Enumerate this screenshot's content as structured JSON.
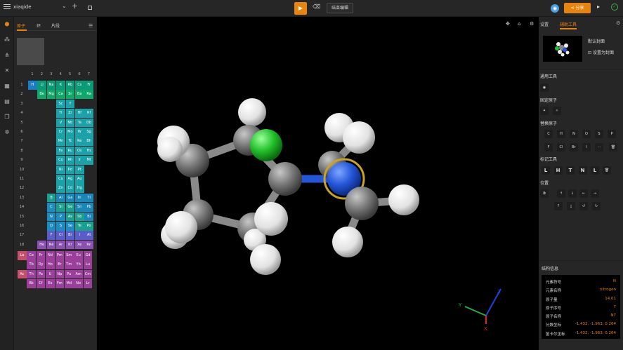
{
  "app": {
    "project_name": "xiaqide"
  },
  "topbar": {
    "end_edit_label": "结束编辑",
    "share_label": "分享",
    "play_icon": "play-icon"
  },
  "left_panel": {
    "tabs": [
      "原子",
      "环",
      "片段"
    ],
    "active_tab": 0,
    "group_numbers": [
      "1",
      "2",
      "3",
      "4",
      "5",
      "6",
      "7"
    ],
    "period_numbers": [
      "1",
      "2",
      "3",
      "4",
      "5",
      "6",
      "7",
      "8",
      "9",
      "10",
      "11",
      "12",
      "13",
      "14",
      "15",
      "16",
      "17",
      "18"
    ],
    "rows": [
      [
        {
          "s": "H",
          "c": "#1a7ec2"
        },
        {
          "s": "Li",
          "c": "#0b9a78"
        },
        {
          "s": "Na",
          "c": "#0b9a78"
        },
        {
          "s": "K",
          "c": "#0b9a78"
        },
        {
          "s": "Rb",
          "c": "#0b9a78"
        },
        {
          "s": "Cs",
          "c": "#0b9a78"
        },
        {
          "s": "Fr",
          "c": "#0b9a78"
        }
      ],
      [
        {
          "s": "Be",
          "c": "#10a76a"
        },
        {
          "s": "Mg",
          "c": "#10a76a"
        },
        {
          "s": "Ca",
          "c": "#10a76a"
        },
        {
          "s": "Sr",
          "c": "#10a76a"
        },
        {
          "s": "Ba",
          "c": "#10a76a"
        },
        {
          "s": "Ra",
          "c": "#10a76a"
        }
      ],
      [
        {
          "s": "Sc",
          "c": "#1aa2a8"
        },
        {
          "s": "Y",
          "c": "#1aa2a8"
        }
      ],
      [
        {
          "s": "Ti",
          "c": "#1aa2a8"
        },
        {
          "s": "Zr",
          "c": "#1aa2a8"
        },
        {
          "s": "Hf",
          "c": "#1aa2a8"
        },
        {
          "s": "Rf",
          "c": "#1aa2a8"
        }
      ],
      [
        {
          "s": "V",
          "c": "#1aa2a8"
        },
        {
          "s": "Nb",
          "c": "#1aa2a8"
        },
        {
          "s": "Ta",
          "c": "#1aa2a8"
        },
        {
          "s": "Db",
          "c": "#1aa2a8"
        }
      ],
      [
        {
          "s": "Cr",
          "c": "#1aa2a8"
        },
        {
          "s": "Mo",
          "c": "#1aa2a8"
        },
        {
          "s": "W",
          "c": "#1aa2a8"
        },
        {
          "s": "Sg",
          "c": "#1aa2a8"
        }
      ],
      [
        {
          "s": "Mn",
          "c": "#1aa2a8"
        },
        {
          "s": "Tc",
          "c": "#1aa2a8"
        },
        {
          "s": "Re",
          "c": "#1aa2a8"
        },
        {
          "s": "Bh",
          "c": "#1aa2a8"
        }
      ],
      [
        {
          "s": "Fe",
          "c": "#1aa2a8"
        },
        {
          "s": "Ru",
          "c": "#1aa2a8"
        },
        {
          "s": "Os",
          "c": "#1aa2a8"
        },
        {
          "s": "Hs",
          "c": "#1aa2a8"
        }
      ],
      [
        {
          "s": "Co",
          "c": "#1aa2a8"
        },
        {
          "s": "Rh",
          "c": "#1aa2a8"
        },
        {
          "s": "Ir",
          "c": "#1aa2a8"
        },
        {
          "s": "Mt",
          "c": "#1aa2a8"
        }
      ],
      [
        {
          "s": "Ni",
          "c": "#1aa2a8"
        },
        {
          "s": "Pd",
          "c": "#1aa2a8"
        },
        {
          "s": "Pt",
          "c": "#1aa2a8"
        }
      ],
      [
        {
          "s": "Cu",
          "c": "#1aa2a8"
        },
        {
          "s": "Ag",
          "c": "#1aa2a8"
        },
        {
          "s": "Au",
          "c": "#1aa2a8"
        }
      ],
      [
        {
          "s": "Zn",
          "c": "#1aa2a8"
        },
        {
          "s": "Cd",
          "c": "#1aa2a8"
        },
        {
          "s": "Hg",
          "c": "#1aa2a8"
        }
      ],
      [
        {
          "s": "B",
          "c": "#1ba090"
        },
        {
          "s": "Al",
          "c": "#1b86b8"
        },
        {
          "s": "Ga",
          "c": "#1b86b8"
        },
        {
          "s": "In",
          "c": "#1b86b8"
        },
        {
          "s": "Tl",
          "c": "#1b86b8"
        }
      ],
      [
        {
          "s": "C",
          "c": "#1b8dc0"
        },
        {
          "s": "Si",
          "c": "#1ba090"
        },
        {
          "s": "Ge",
          "c": "#1ba090"
        },
        {
          "s": "Sn",
          "c": "#1b86b8"
        },
        {
          "s": "Pb",
          "c": "#1b86b8"
        }
      ],
      [
        {
          "s": "N",
          "c": "#1b8dc0"
        },
        {
          "s": "P",
          "c": "#1b8dc0"
        },
        {
          "s": "As",
          "c": "#1ba090"
        },
        {
          "s": "Sb",
          "c": "#1ba090"
        },
        {
          "s": "Bi",
          "c": "#1b86b8"
        }
      ],
      [
        {
          "s": "O",
          "c": "#1b8dc0"
        },
        {
          "s": "S",
          "c": "#1b8dc0"
        },
        {
          "s": "Se",
          "c": "#1b8dc0"
        },
        {
          "s": "Te",
          "c": "#1ba090"
        },
        {
          "s": "Po",
          "c": "#1ba090"
        }
      ],
      [
        {
          "s": "F",
          "c": "#5a5cc8"
        },
        {
          "s": "Cl",
          "c": "#5a5cc8"
        },
        {
          "s": "Br",
          "c": "#5a5cc8"
        },
        {
          "s": "I",
          "c": "#5a5cc8"
        },
        {
          "s": "At",
          "c": "#5a5cc8"
        }
      ],
      [
        {
          "s": "He",
          "c": "#8a4fb0"
        },
        {
          "s": "Ne",
          "c": "#8a4fb0"
        },
        {
          "s": "Ar",
          "c": "#8a4fb0"
        },
        {
          "s": "Kr",
          "c": "#8a4fb0"
        },
        {
          "s": "Xe",
          "c": "#8a4fb0"
        },
        {
          "s": "Rn",
          "c": "#8a4fb0"
        }
      ]
    ],
    "f_rows": [
      [
        {
          "s": "La",
          "c": "#c4506c",
          "x": 0
        },
        {
          "s": "Ce",
          "c": "#9a3f9a",
          "x": 1
        },
        {
          "s": "Pr",
          "c": "#9a3f9a",
          "x": 2
        },
        {
          "s": "Nd",
          "c": "#9a3f9a",
          "x": 3
        },
        {
          "s": "Pm",
          "c": "#9a3f9a",
          "x": 4
        },
        {
          "s": "Sm",
          "c": "#9a3f9a",
          "x": 5
        },
        {
          "s": "Eu",
          "c": "#9a3f9a",
          "x": 6
        },
        {
          "s": "Gd",
          "c": "#9a3f9a",
          "x": 7
        }
      ],
      [
        {
          "s": "Tb",
          "c": "#9a3f9a",
          "x": 1
        },
        {
          "s": "Dy",
          "c": "#9a3f9a",
          "x": 2
        },
        {
          "s": "Ho",
          "c": "#9a3f9a",
          "x": 3
        },
        {
          "s": "Er",
          "c": "#9a3f9a",
          "x": 4
        },
        {
          "s": "Tm",
          "c": "#9a3f9a",
          "x": 5
        },
        {
          "s": "Yb",
          "c": "#9a3f9a",
          "x": 6
        },
        {
          "s": "Lu",
          "c": "#9a3f9a",
          "x": 7
        }
      ],
      [
        {
          "s": "Ac",
          "c": "#c4506c",
          "x": 0
        },
        {
          "s": "Th",
          "c": "#9a3f9a",
          "x": 1
        },
        {
          "s": "Pa",
          "c": "#9a3f9a",
          "x": 2
        },
        {
          "s": "U",
          "c": "#9a3f9a",
          "x": 3
        },
        {
          "s": "Np",
          "c": "#9a3f9a",
          "x": 4
        },
        {
          "s": "Pu",
          "c": "#9a3f9a",
          "x": 5
        },
        {
          "s": "Am",
          "c": "#9a3f9a",
          "x": 6
        },
        {
          "s": "Cm",
          "c": "#9a3f9a",
          "x": 7
        }
      ],
      [
        {
          "s": "Bk",
          "c": "#9a3f9a",
          "x": 1
        },
        {
          "s": "Cf",
          "c": "#9a3f9a",
          "x": 2
        },
        {
          "s": "Es",
          "c": "#9a3f9a",
          "x": 3
        },
        {
          "s": "Fm",
          "c": "#9a3f9a",
          "x": 4
        },
        {
          "s": "Md",
          "c": "#9a3f9a",
          "x": 5
        },
        {
          "s": "No",
          "c": "#9a3f9a",
          "x": 6
        },
        {
          "s": "Lr",
          "c": "#9a3f9a",
          "x": 7
        }
      ]
    ]
  },
  "viewport": {
    "axis_x": "X",
    "axis_y": "Y",
    "axis_z": "Z"
  },
  "right_panel": {
    "tabs": [
      "设置",
      "辅助工具"
    ],
    "active_tab": 1,
    "default_cover": "默认封面",
    "set_cover": "设置为封面",
    "sections": {
      "general": "通用工具",
      "fixed_atoms": "固定原子",
      "replace_atoms": "替换原子",
      "mark_tools": "标记工具",
      "position": "位置"
    },
    "replace_row1": [
      "C",
      "H",
      "N",
      "O",
      "S",
      "P"
    ],
    "replace_row2": [
      "F",
      "Cl",
      "Br",
      "I",
      "···"
    ],
    "mark_row": [
      "L",
      "H",
      "T",
      "N",
      "L"
    ],
    "info_title": "结构信息",
    "info": [
      {
        "k": "元素符号",
        "v": "N"
      },
      {
        "k": "元素名称",
        "v": "nitrogen"
      },
      {
        "k": "原子量",
        "v": "14.01"
      },
      {
        "k": "原子序号",
        "v": "7"
      },
      {
        "k": "原子名称",
        "v": "N7"
      },
      {
        "k": "分数坐标",
        "v": "-1.432, -1.963, 0.264"
      },
      {
        "k": "笛卡尔坐标",
        "v": "-1.432, -1.963, 0.264"
      }
    ]
  },
  "colors": {
    "accent": "#e8830c",
    "carbon": "#7a7a7a",
    "hydrogen": "#eeeeee",
    "nitrogen": "#2457d6",
    "chlorine": "#22c12a",
    "selection": "#c9a227"
  }
}
